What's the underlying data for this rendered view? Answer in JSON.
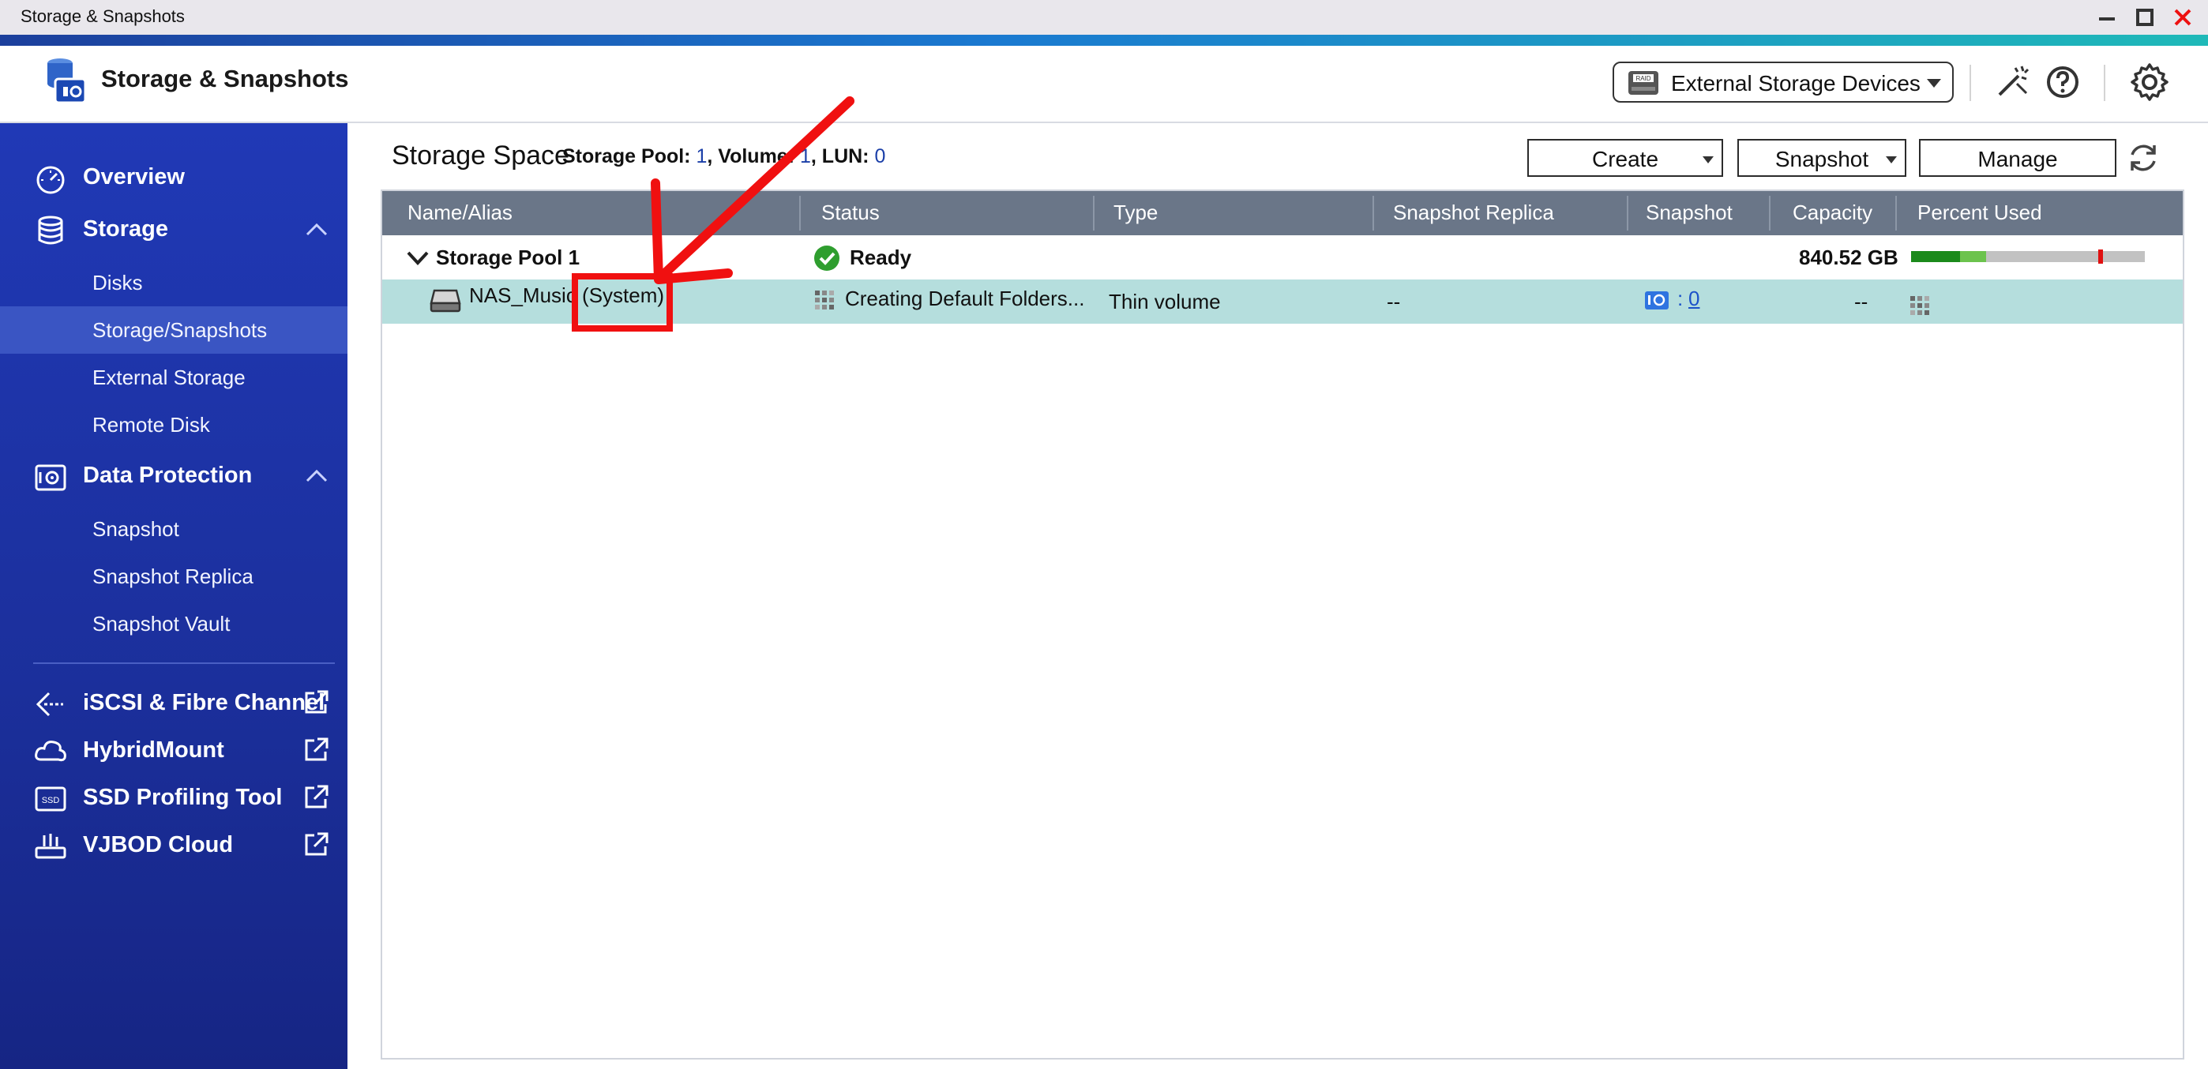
{
  "window": {
    "title": "Storage & Snapshots"
  },
  "header": {
    "app_title": "Storage & Snapshots",
    "external_storage_label": "External Storage Devices"
  },
  "sidebar": {
    "overview": "Overview",
    "storage": "Storage",
    "storage_items": [
      "Disks",
      "Storage/Snapshots",
      "External Storage",
      "Remote Disk"
    ],
    "data_protection": "Data Protection",
    "data_protection_items": [
      "Snapshot",
      "Snapshot Replica",
      "Snapshot Vault"
    ],
    "external_apps": [
      "iSCSI & Fibre Channel",
      "HybridMount",
      "SSD Profiling Tool",
      "VJBOD Cloud"
    ]
  },
  "main": {
    "title": "Storage Space",
    "pool_label": "Storage Pool:",
    "pool_count": "1",
    "volume_label": ", Volume:",
    "volume_count": "1",
    "lun_label": ", LUN:",
    "lun_count": "0",
    "buttons": {
      "create": "Create",
      "snapshot": "Snapshot",
      "manage": "Manage"
    }
  },
  "table": {
    "columns": [
      "Name/Alias",
      "Status",
      "Type",
      "Snapshot Replica",
      "Snapshot",
      "Capacity",
      "Percent Used"
    ],
    "pool_row": {
      "name": "Storage Pool 1",
      "status": "Ready",
      "capacity": "840.52 GB",
      "percent_used": {
        "used_fraction": 0.21,
        "secondary_fraction": 0.11,
        "threshold_fraction": 0.8
      }
    },
    "volume_row": {
      "name": "NAS_Music (System)",
      "status": "Creating Default Folders...",
      "type": "Thin volume",
      "snapshot_replica": "--",
      "snapshot_sep": ":",
      "snapshot_count": "0",
      "capacity": "--"
    }
  },
  "colors": {
    "sidebar": "#1f36b0",
    "table_header": "#6a7688",
    "selected_row": "#b5dedd",
    "annotation": "#f01010"
  }
}
